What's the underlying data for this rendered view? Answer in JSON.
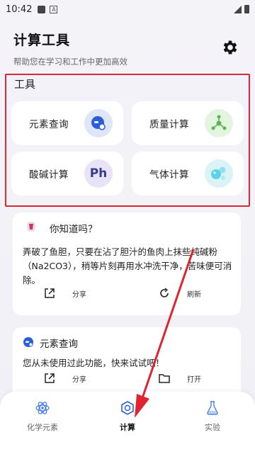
{
  "status_bar": {
    "time": "10:42",
    "indicator": "A"
  },
  "header": {
    "title": "计算工具",
    "subtitle": "帮助您在学习和工作中更加高效",
    "settings_icon": "gear-icon"
  },
  "tools": {
    "section_label": "工具",
    "items": [
      {
        "label": "元素查询",
        "icon": "element-search-icon"
      },
      {
        "label": "质量计算",
        "icon": "molecule-icon"
      },
      {
        "label": "酸碱计算",
        "icon": "ph-icon",
        "icon_text": "Ph"
      },
      {
        "label": "气体计算",
        "icon": "bubbles-icon"
      }
    ]
  },
  "tip_card": {
    "title": "你知道吗？",
    "body": "弄破了鱼胆，只要在沾了胆汁的鱼肉上抹些纯碱粉（Na2CO3），稍等片刻再用水冲洗干净，苦味便可消除。",
    "share_label": "分享",
    "refresh_label": "刷新"
  },
  "feature_card": {
    "title": "元素查询",
    "body": "您从未使用过此功能，快来试试吧！",
    "share_label": "分享",
    "open_label": "打开"
  },
  "bottom_nav": [
    {
      "label": "化学元素",
      "icon": "atom-icon",
      "active": false
    },
    {
      "label": "计算",
      "icon": "calculator-hex-icon",
      "active": true
    },
    {
      "label": "实验",
      "icon": "flask-icon",
      "active": false
    }
  ],
  "colors": {
    "highlight_border": "#d8283a",
    "arrow": "#e0242f",
    "accent_blue": "#2b5fd9"
  }
}
